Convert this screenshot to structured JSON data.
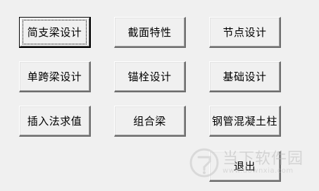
{
  "buttons": {
    "simply_supported_beam": "简支梁设计",
    "section_properties": "截面特性",
    "node_design": "节点设计",
    "single_span_beam": "单跨梁设计",
    "anchor_bolt": "锚栓设计",
    "foundation": "基础设计",
    "interpolation": "插入法求值",
    "composite_beam": "组合梁",
    "concrete_filled_steel_tube": "钢管混凝土柱",
    "exit": "退出"
  },
  "watermark": {
    "title": "当下软件园",
    "url": "www.downxia.com"
  },
  "colors": {
    "background": "#f0f0f0",
    "button_face": "#f0f0f0",
    "button_shadow": "#6d6d6d",
    "watermark": "#bdbdbd"
  }
}
